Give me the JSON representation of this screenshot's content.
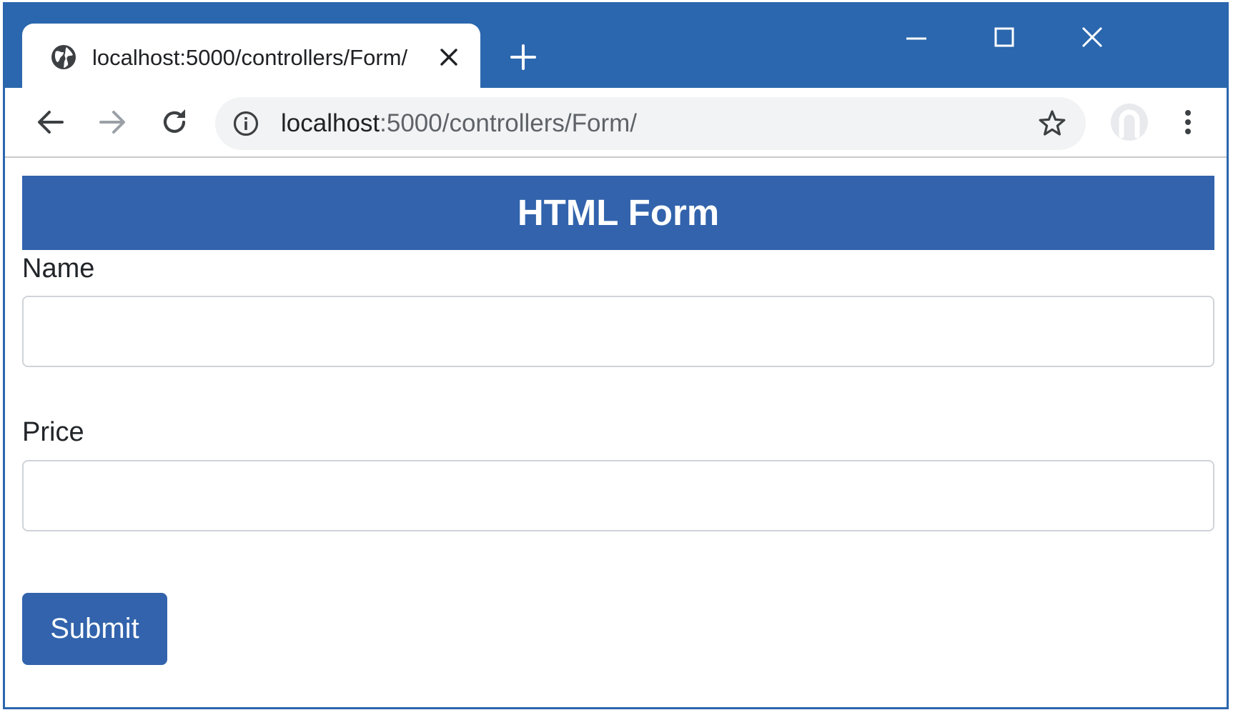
{
  "browser": {
    "tab": {
      "title": "localhost:5000/controllers/Form/"
    },
    "address": {
      "host": "localhost",
      "path": ":5000/controllers/Form/"
    },
    "icons": {
      "tab_favicon": "globe-icon",
      "tab_close": "close-icon",
      "new_tab": "plus-icon",
      "minimize": "minimize-icon",
      "maximize": "maximize-icon",
      "close_window": "close-icon",
      "back": "arrow-left-icon",
      "forward": "arrow-right-icon",
      "reload": "reload-icon",
      "site_info": "info-icon",
      "bookmark": "star-icon",
      "profile": "profile-icon",
      "menu": "kebab-menu-icon"
    },
    "colors": {
      "frame": "#2b67ae",
      "omnibox": "#f1f3f4"
    }
  },
  "page": {
    "header": "HTML Form",
    "form": {
      "name_label": "Name",
      "name_value": "",
      "price_label": "Price",
      "price_value": "",
      "submit_label": "Submit"
    },
    "colors": {
      "primary": "#3263ac",
      "input_border": "#d0d4d9"
    }
  }
}
